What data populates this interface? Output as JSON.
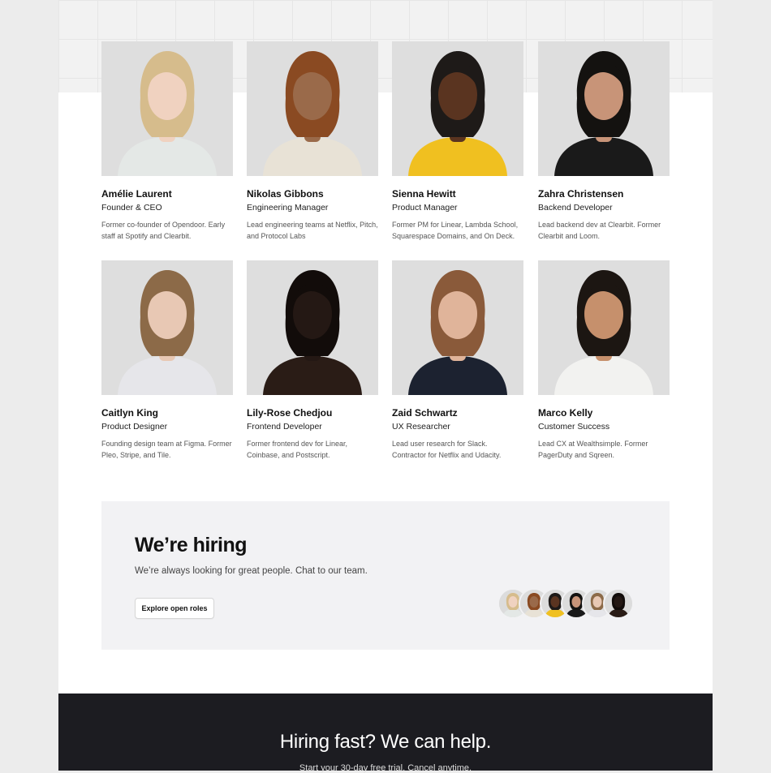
{
  "team": [
    {
      "name": "Amélie Laurent",
      "role": "Founder & CEO",
      "bio": "Former co-founder of Opendoor. Early staff at Spotify and Clearbit.",
      "skin": "#f0d2c0",
      "hair": "#d6bc8c",
      "shirt": "#e4e8e6"
    },
    {
      "name": "Nikolas Gibbons",
      "role": "Engineering Manager",
      "bio": "Lead engineering teams at Netflix, Pitch, and Protocol Labs",
      "skin": "#9a6a4a",
      "hair": "#8a4a22",
      "shirt": "#e8e2d6"
    },
    {
      "name": "Sienna Hewitt",
      "role": "Product Manager",
      "bio": "Former PM for Linear, Lambda School, Squarespace Domains, and On Deck.",
      "skin": "#5a3420",
      "hair": "#1e1a18",
      "shirt": "#f0c020"
    },
    {
      "name": "Zahra Christensen",
      "role": "Backend Developer",
      "bio": "Lead backend dev at Clearbit. Former Clearbit and Loom.",
      "skin": "#c89478",
      "hair": "#141210",
      "shirt": "#1a1a1a"
    },
    {
      "name": "Caitlyn King",
      "role": "Product Designer",
      "bio": "Founding design team at Figma. Former Pleo, Stripe, and Tile.",
      "skin": "#e8c8b4",
      "hair": "#8c6a48",
      "shirt": "#e6e6ea"
    },
    {
      "name": "Lily-Rose Chedjou",
      "role": "Frontend Developer",
      "bio": "Former frontend dev for Linear, Coinbase, and Postscript.",
      "skin": "#241814",
      "hair": "#120c0a",
      "shirt": "#2a1c16"
    },
    {
      "name": "Zaid Schwartz",
      "role": "UX Researcher",
      "bio": "Lead user research for Slack. Contractor for Netflix and Udacity.",
      "skin": "#e0b49a",
      "hair": "#8a5a3a",
      "shirt": "#1c2230"
    },
    {
      "name": "Marco Kelly",
      "role": "Customer Success",
      "bio": "Lead CX at Wealthsimple. Former PagerDuty and Sqreen.",
      "skin": "#c6906c",
      "hair": "#1c1612",
      "shirt": "#f2f2f0"
    }
  ],
  "hiring": {
    "title": "We’re hiring",
    "subtitle": "We’re always looking for great people. Chat to our team.",
    "button": "Explore open roles"
  },
  "cta": {
    "title": "Hiring fast? We can help.",
    "subtitle": "Start your 30-day free trial. Cancel anytime."
  },
  "colors": {
    "page_bg": "#ececec",
    "cta_bg": "#1c1c21",
    "hiring_bg": "#f2f2f4"
  }
}
